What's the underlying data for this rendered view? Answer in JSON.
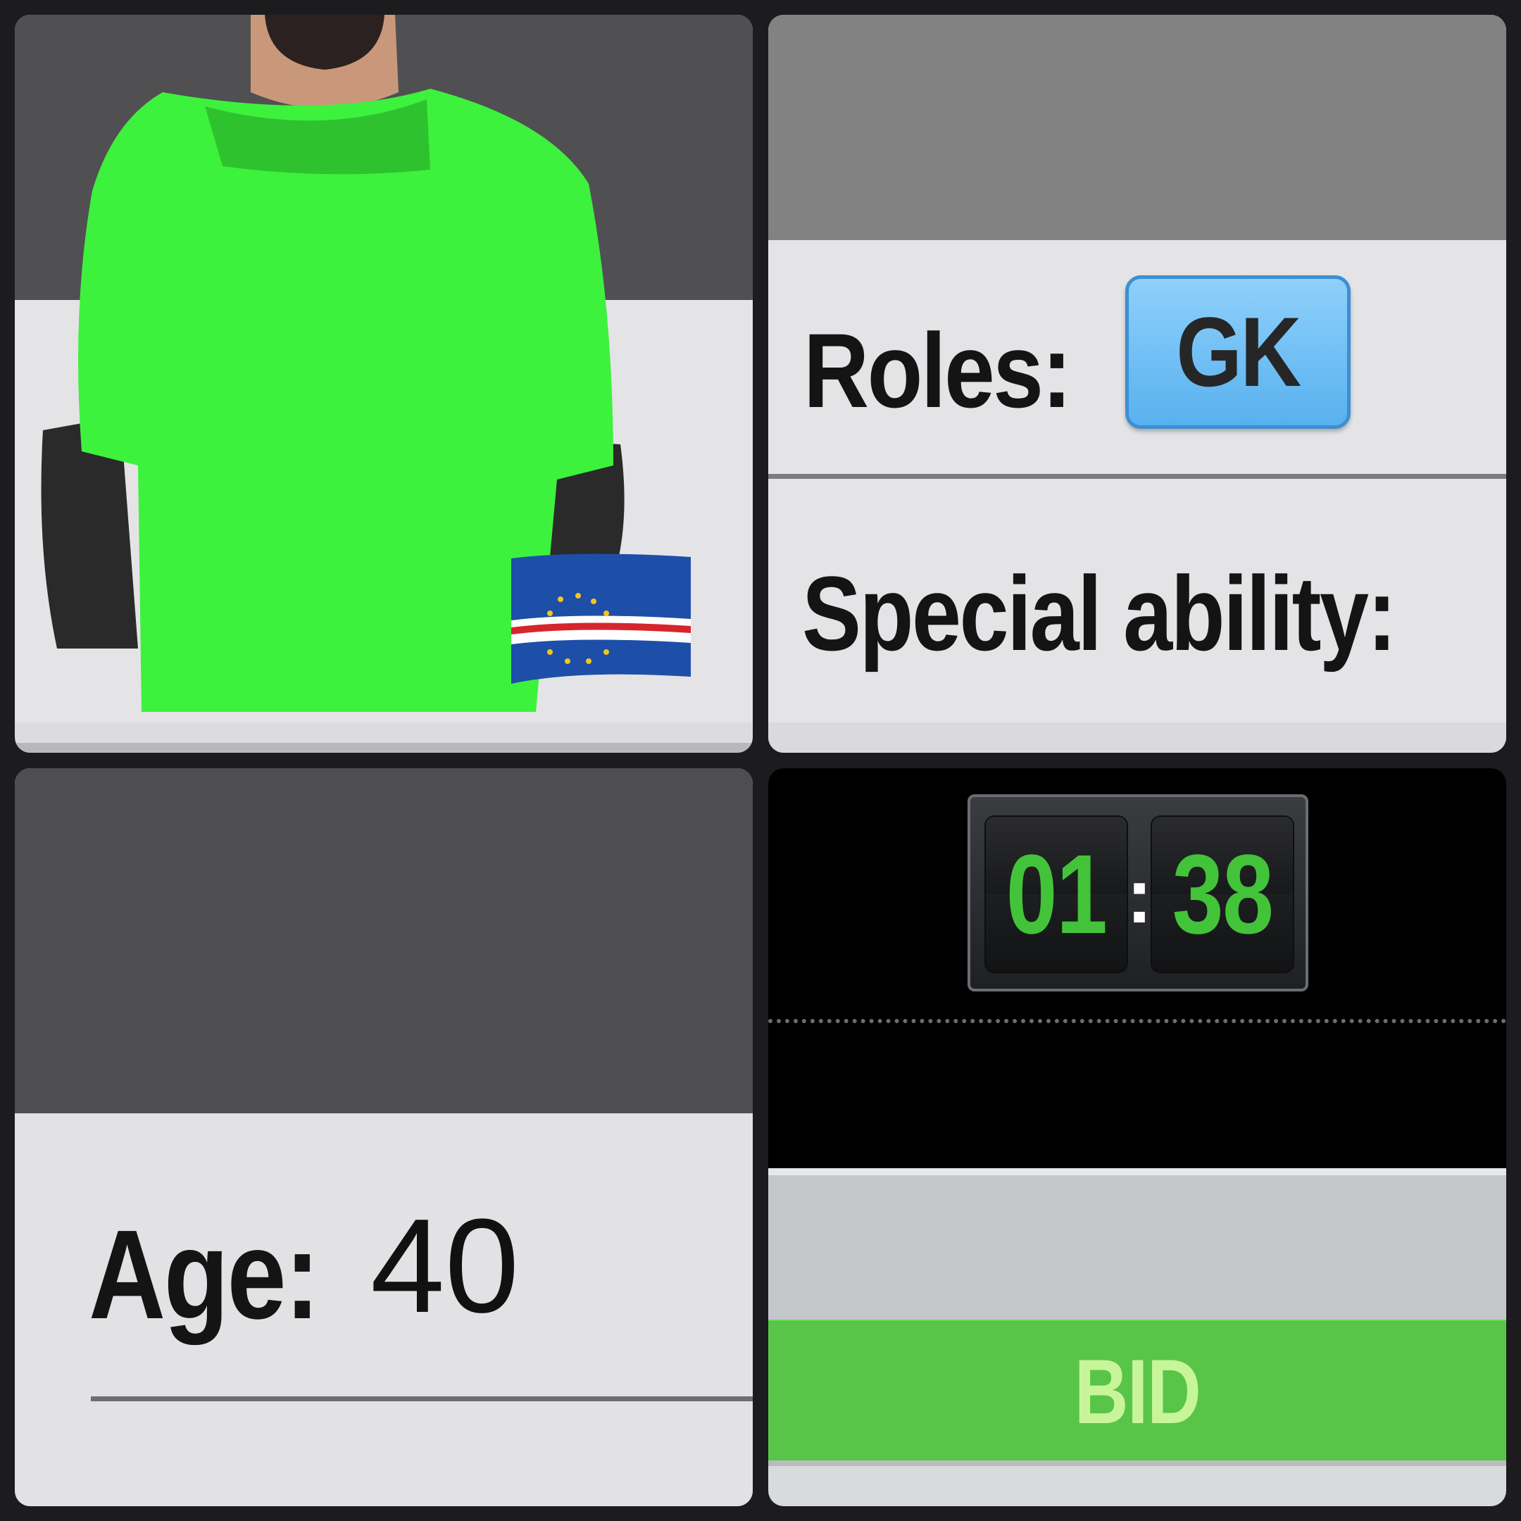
{
  "player": {
    "jersey_color": "#3df23d",
    "sleeve_color": "#2a2a2a",
    "flag": "cape-verde-flag-icon"
  },
  "info": {
    "roles_label": "Roles:",
    "role_badge": "GK",
    "badge_color": "#6cbdf5",
    "special_ability_label": "Special ability:"
  },
  "age": {
    "label": "Age:",
    "value": "40"
  },
  "auction": {
    "timer_minutes": "01",
    "timer_separator": ":",
    "timer_seconds": "38",
    "timer_digit_color": "#43c33a",
    "bid_label": "BID",
    "bid_button_color": "#58c548"
  }
}
